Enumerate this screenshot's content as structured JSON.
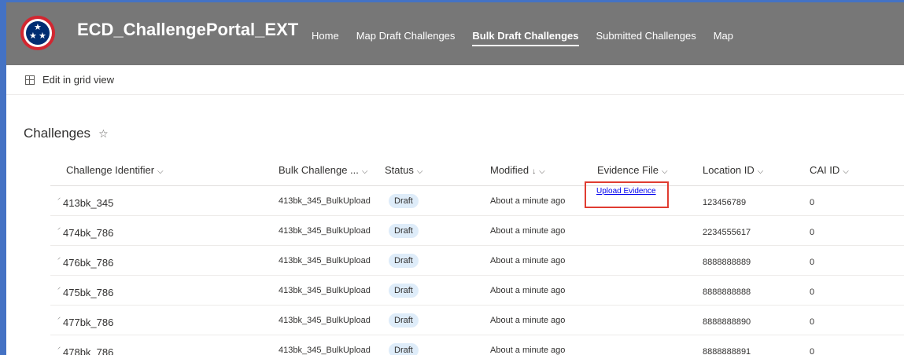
{
  "site": {
    "title": "ECD_ChallengePortal_EXT",
    "logo_icon": "tennessee-tri-star-icon"
  },
  "nav": {
    "items": [
      {
        "label": "Home",
        "active": false
      },
      {
        "label": "Map Draft Challenges",
        "active": false
      },
      {
        "label": "Bulk Draft Challenges",
        "active": true
      },
      {
        "label": "Submitted Challenges",
        "active": false
      },
      {
        "label": "Map",
        "active": false
      }
    ]
  },
  "toolbar": {
    "grid_icon": "grid-icon",
    "grid_label": "Edit in grid view"
  },
  "list": {
    "title": "Challenges",
    "favorite_icon": "☆"
  },
  "columns": {
    "id": "Challenge Identifier",
    "bulk": "Bulk Challenge ...",
    "status": "Status",
    "modified": "Modified",
    "evidence": "Evidence File",
    "location": "Location ID",
    "cai": "CAI ID",
    "chevron": "⌵",
    "sort_arrow": "↓"
  },
  "rows": [
    {
      "id": "413bk_345",
      "bulk": "413bk_345_BulkUpload",
      "status": "Draft",
      "modified": "About a minute ago",
      "location": "123456789",
      "cai": "0"
    },
    {
      "id": "474bk_786",
      "bulk": "413bk_345_BulkUpload",
      "status": "Draft",
      "modified": "About a minute ago",
      "location": "2234555617",
      "cai": "0"
    },
    {
      "id": "476bk_786",
      "bulk": "413bk_345_BulkUpload",
      "status": "Draft",
      "modified": "About a minute ago",
      "location": "8888888889",
      "cai": "0"
    },
    {
      "id": "475bk_786",
      "bulk": "413bk_345_BulkUpload",
      "status": "Draft",
      "modified": "About a minute ago",
      "location": "8888888888",
      "cai": "0"
    },
    {
      "id": "477bk_786",
      "bulk": "413bk_345_BulkUpload",
      "status": "Draft",
      "modified": "About a minute ago",
      "location": "8888888890",
      "cai": "0"
    },
    {
      "id": "478bk_786",
      "bulk": "413bk_345_BulkUpload",
      "status": "Draft",
      "modified": "About a minute ago",
      "location": "8888888891",
      "cai": "0"
    }
  ],
  "evidence_link": "Upload Evidence",
  "new_item_mark": "⸝",
  "colors": {
    "header_bg": "#777777",
    "frame": "#4472c4",
    "status_badge": "#deecf9",
    "highlight": "#e03c31",
    "link": "#0000ee"
  }
}
